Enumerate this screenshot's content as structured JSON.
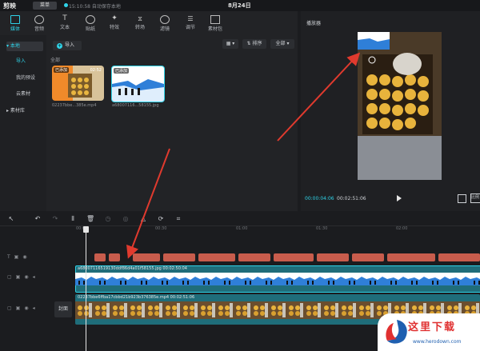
{
  "titlebar": {
    "logo": "剪映",
    "menu": "菜单",
    "autosave": "15:10:58 自动保存本地",
    "project": "8月24日"
  },
  "toolbar": {
    "items": [
      {
        "label": "媒体",
        "icon": "media-icon"
      },
      {
        "label": "音频",
        "icon": "audio-icon"
      },
      {
        "label": "文本",
        "icon": "text-icon"
      },
      {
        "label": "贴纸",
        "icon": "sticker-icon"
      },
      {
        "label": "特效",
        "icon": "effects-icon"
      },
      {
        "label": "转场",
        "icon": "transition-icon"
      },
      {
        "label": "滤镜",
        "icon": "filter-icon"
      },
      {
        "label": "调节",
        "icon": "adjust-icon"
      },
      {
        "label": "素材包",
        "icon": "package-icon"
      }
    ]
  },
  "sidebar": {
    "items": [
      "本地",
      "导入",
      "我的预设",
      "云素材",
      "素材库"
    ]
  },
  "media": {
    "import_label": "导入",
    "all_label": "全部",
    "sort_label": "排序",
    "filter_label": "全部",
    "files": [
      {
        "badge": "已添加",
        "duration": "02:52",
        "name": "02237bbe...385e.mp4"
      },
      {
        "badge": "已添加",
        "duration": "",
        "name": "a68007116...58155.jpg"
      }
    ]
  },
  "player": {
    "title": "播放器",
    "current": "00:00:04:06",
    "total": "00:02:51:06",
    "ratio": "比例"
  },
  "ruler": {
    "ticks": [
      "00:00",
      "00:30",
      "01:00",
      "01:30",
      "02:00"
    ]
  },
  "tracks": {
    "image_label": "a68007116519130ddf86d4a01f58155.jpg  00:02:50:04",
    "video_label": "02237bbe6ffba17cbbd21b923b376385e.mp4  00:02:51:06",
    "cover": "封面"
  },
  "watermark": {
    "text": "这里下载",
    "url": "www.herodown.com"
  },
  "colors": {
    "accent": "#2fd3e8",
    "text_clip": "#c85c4c",
    "track": "#1f6d7a",
    "arrow": "#e03a2e"
  }
}
